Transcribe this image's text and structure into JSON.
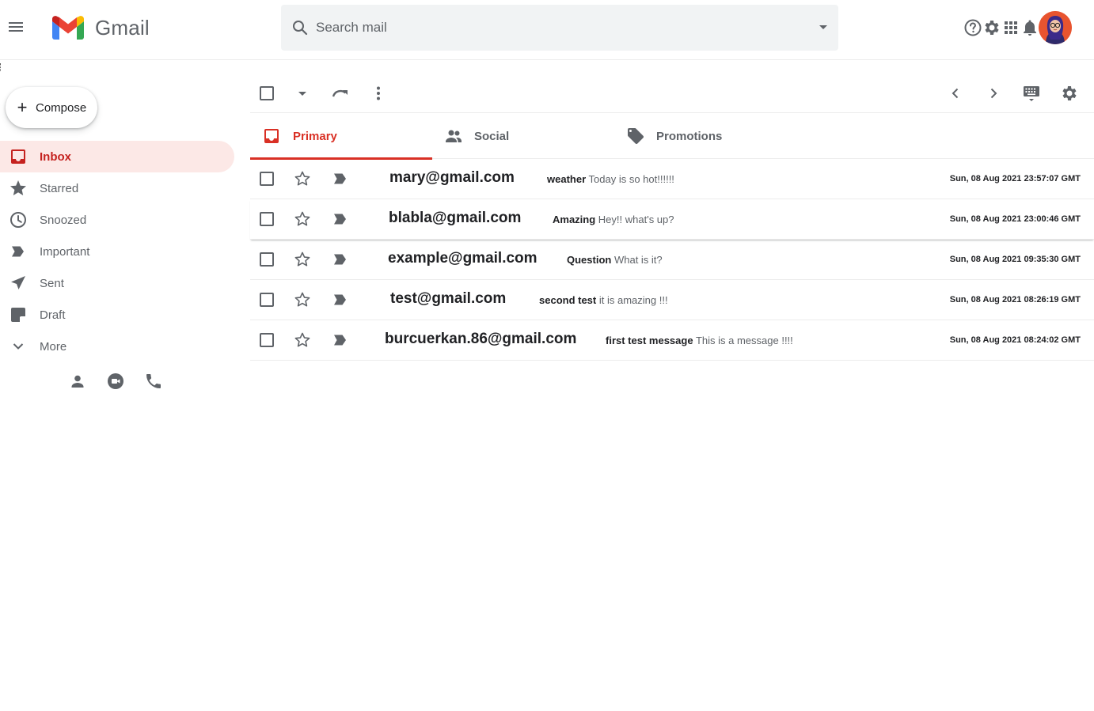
{
  "app": {
    "name": "Gmail"
  },
  "search": {
    "placeholder": "Search mail"
  },
  "compose": {
    "label": "Compose"
  },
  "nav": [
    {
      "label": "Inbox",
      "icon": "inbox-icon",
      "active": true
    },
    {
      "label": "Starred",
      "icon": "star-icon"
    },
    {
      "label": "Snoozed",
      "icon": "clock-icon"
    },
    {
      "label": "Important",
      "icon": "label-important-icon"
    },
    {
      "label": "Sent",
      "icon": "send-icon"
    },
    {
      "label": "Draft",
      "icon": "draft-icon"
    },
    {
      "label": "More",
      "icon": "chevron-down-icon"
    }
  ],
  "tabs": [
    {
      "label": "Primary",
      "icon": "inbox-icon",
      "active": true
    },
    {
      "label": "Social",
      "icon": "people-icon"
    },
    {
      "label": "Promotions",
      "icon": "tag-icon"
    }
  ],
  "emails": [
    {
      "sender": "mary@gmail.com",
      "subject": "weather",
      "snippet": "Today is so hot!!!!!!",
      "date": "Sun, 08 Aug 2021 23:57:07 GMT"
    },
    {
      "sender": "blabla@gmail.com",
      "subject": "Amazing",
      "snippet": "Hey!! what's up?",
      "date": "Sun, 08 Aug 2021 23:00:46 GMT"
    },
    {
      "sender": "example@gmail.com",
      "subject": "Question",
      "snippet": "What is it?",
      "date": "Sun, 08 Aug 2021 09:35:30 GMT"
    },
    {
      "sender": "test@gmail.com",
      "subject": "second test",
      "snippet": "it is amazing !!!",
      "date": "Sun, 08 Aug 2021 08:26:19 GMT"
    },
    {
      "sender": "burcuerkan.86@gmail.com",
      "subject": "first test message",
      "snippet": "This is a message !!!!",
      "date": "Sun, 08 Aug 2021 08:24:02 GMT"
    }
  ],
  "colors": {
    "accent": "#d93025",
    "active_bg": "#fce8e6",
    "icon": "#5f6368"
  }
}
